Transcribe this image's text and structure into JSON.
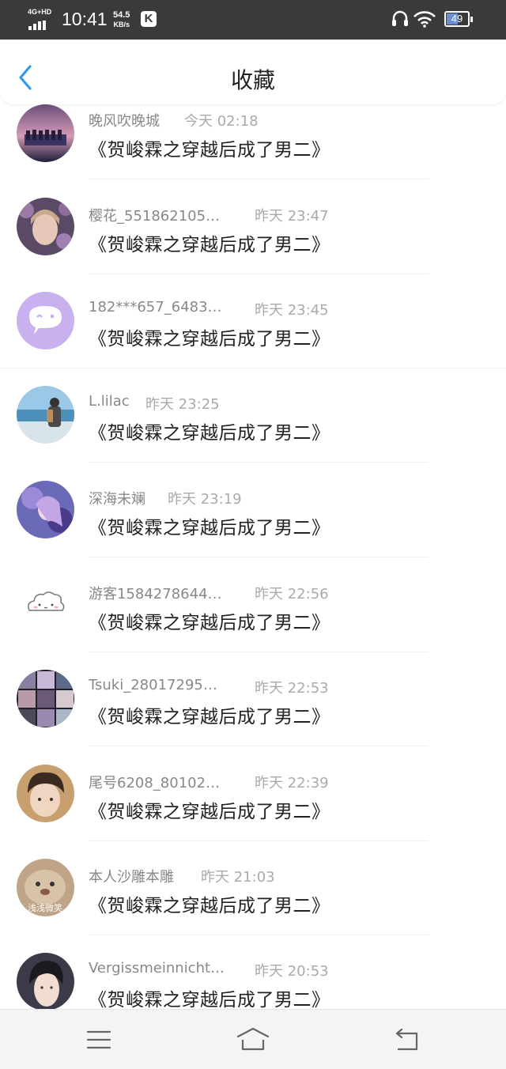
{
  "status_bar": {
    "network": "4G+HD",
    "time": "10:41",
    "speed_value": "54.5",
    "speed_unit": "KB/s",
    "app_badge": "K",
    "battery": "49"
  },
  "header": {
    "title": "收藏",
    "back_icon": "chevron-left-icon"
  },
  "items": [
    {
      "name": "晚风吹晚城",
      "time": "今天 02:18",
      "message": "《贺峻霖之穿越后成了男二》"
    },
    {
      "name": "樱花_551862105…",
      "time": "昨天 23:47",
      "message": "《贺峻霖之穿越后成了男二》"
    },
    {
      "name": "182***657_6483…",
      "time": "昨天 23:45",
      "message": "《贺峻霖之穿越后成了男二》"
    },
    {
      "name": "L.lilac",
      "time": "昨天 23:25",
      "message": "《贺峻霖之穿越后成了男二》"
    },
    {
      "name": "深海未斓",
      "time": "昨天 23:19",
      "message": "《贺峻霖之穿越后成了男二》"
    },
    {
      "name": "游客1584278644…",
      "time": "昨天 22:56",
      "message": "《贺峻霖之穿越后成了男二》"
    },
    {
      "name": "Tsuki_28017295…",
      "time": "昨天 22:53",
      "message": "《贺峻霖之穿越后成了男二》"
    },
    {
      "name": "尾号6208_80102…",
      "time": "昨天 22:39",
      "message": "《贺峻霖之穿越后成了男二》"
    },
    {
      "name": "本人沙雕本雕",
      "time": "昨天 21:03",
      "message": "《贺峻霖之穿越后成了男二》",
      "avatar_caption": "浅浅微笑"
    },
    {
      "name": "Vergissmeinnicht…",
      "time": "昨天 20:53",
      "message": "《贺峻霖之穿越后成了男二》"
    }
  ],
  "nav": {
    "menu_icon": "menu-icon",
    "home_icon": "home-icon",
    "back_icon": "back-arrow-icon"
  },
  "colors": {
    "accent": "#2f9bf0",
    "status_bar": "#3a3a3a",
    "name_text": "#888888",
    "message_text": "#222222"
  }
}
